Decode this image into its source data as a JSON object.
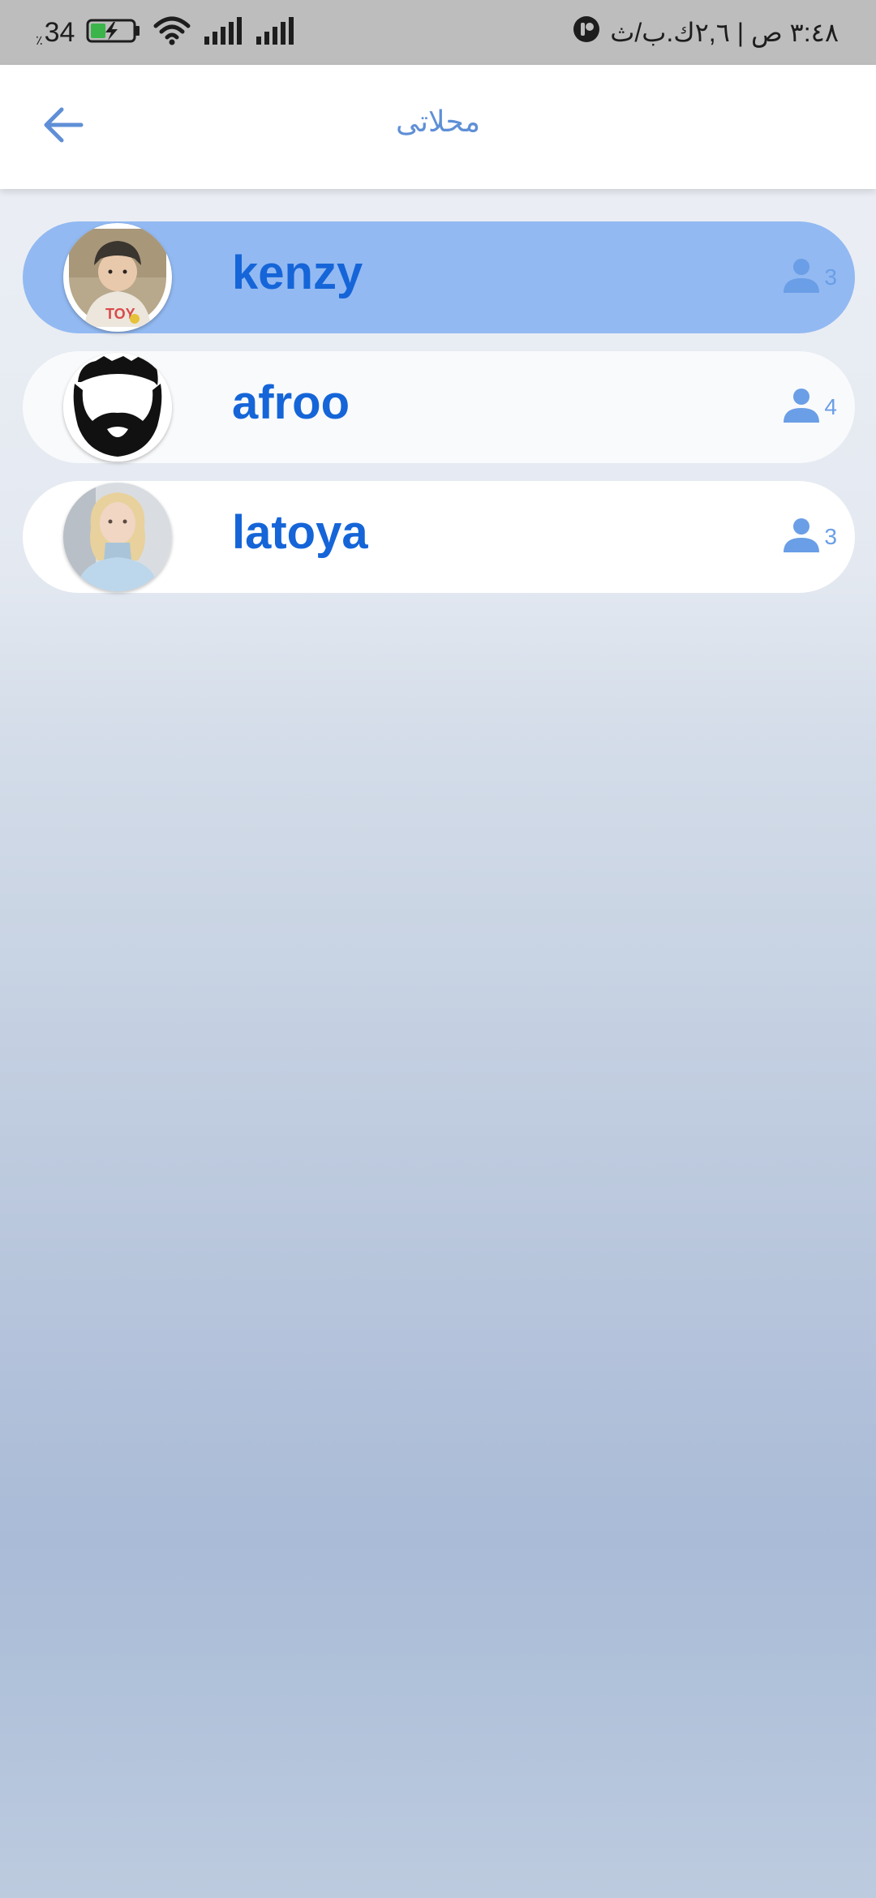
{
  "status_bar": {
    "battery_percent": "34",
    "percent_sign": "٪",
    "right_text": "٣:٤٨ ص | ٢,٦ك.ب/ث"
  },
  "header": {
    "title": "محلاتى"
  },
  "stores": [
    {
      "name": "kenzy",
      "members": "3",
      "selected": true
    },
    {
      "name": "afroo",
      "members": "4",
      "selected": false
    },
    {
      "name": "latoya",
      "members": "3",
      "selected": false
    }
  ],
  "colors": {
    "accent": "#1565d8",
    "selected_row": "#92b9f2",
    "icon": "#6a9ee6"
  }
}
